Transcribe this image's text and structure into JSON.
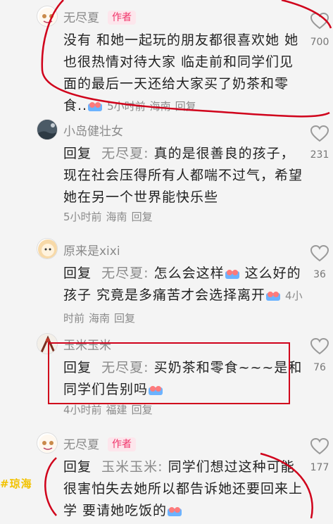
{
  "comments": [
    {
      "username": "无尽夏",
      "author_tag": "作者",
      "text": "没有 和她一起玩的朋友都很喜欢她 她也很热情对待大家 临走前和同学们见面的最后一天还给大家买了奶茶和零食..",
      "time": "5小时前",
      "location": "海南",
      "reply_label": "回复",
      "likes": "700"
    },
    {
      "username": "小岛健壮女",
      "reply_prefix": "回复",
      "reply_target": "无尽夏:",
      "text": "真的是很善良的孩子，现在社会压得所有人都喘不过气，希望她在另一个世界能快乐些",
      "time": "5小时前",
      "location": "海南",
      "reply_label": "回复",
      "likes": "231"
    },
    {
      "username": "原来是xixi",
      "reply_prefix": "回复",
      "reply_target": "无尽夏:",
      "text": "怎么会这样",
      "text2": "这么好的孩子 究竟是多痛苦才会选择离开",
      "time": "4小时前",
      "location": "海南",
      "reply_label": "回复",
      "likes": "36"
    },
    {
      "username": "玉米玉米",
      "reply_prefix": "回复",
      "reply_target": "无尽夏:",
      "text": "买奶茶和零食~~~是和同学们告别吗",
      "time": "4小时前",
      "location": "福建",
      "reply_label": "回复",
      "likes": "76"
    },
    {
      "username": "无尽夏",
      "author_tag": "作者",
      "reply_prefix": "回复",
      "reply_target": "玉米玉米:",
      "text": "同学们想过这种可能 很害怕失去她所以都告诉她还要回来上学 要请她吃饭的",
      "likes": "177"
    }
  ],
  "watermark": "#琼海",
  "colors": {
    "annotation_red": "#d0021b",
    "author_tag": "#f0346a",
    "watermark": "#f2c200"
  }
}
